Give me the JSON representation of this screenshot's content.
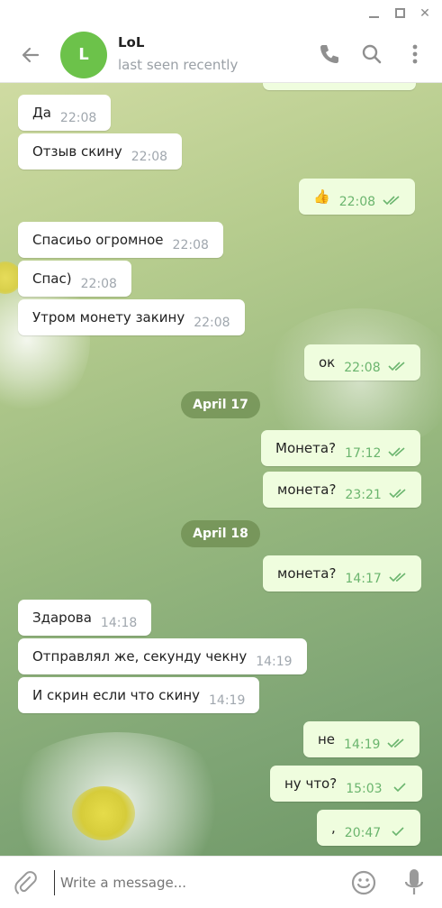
{
  "window": {
    "minimize_label": "",
    "maximize_label": "",
    "close_label": "✕"
  },
  "header": {
    "avatar_letter": "L",
    "name": "LoL",
    "status": "last seen recently"
  },
  "colors": {
    "accent": "#6cc24a",
    "outgoing_bubble": "#effdde",
    "incoming_bubble": "#ffffff",
    "read_ticks": "#6bb56e",
    "date_pill": "#6e8c50"
  },
  "messages": [
    {
      "dir": "in",
      "text": "Да",
      "time": "22:08"
    },
    {
      "dir": "in",
      "text": "Отзыв скину",
      "time": "22:08"
    },
    {
      "dir": "out",
      "text": "👍",
      "time": "22:08",
      "status": "read"
    },
    {
      "dir": "in",
      "text": "Спасиьо огромное",
      "time": "22:08"
    },
    {
      "dir": "in",
      "text": "Спас)",
      "time": "22:08"
    },
    {
      "dir": "in",
      "text": "Утром монету закину",
      "time": "22:08"
    },
    {
      "dir": "out",
      "text": "ок",
      "time": "22:08",
      "status": "read"
    },
    {
      "date": "April 17"
    },
    {
      "dir": "out",
      "text": "Монета?",
      "time": "17:12",
      "status": "read"
    },
    {
      "dir": "out",
      "text": "монета?",
      "time": "23:21",
      "status": "read"
    },
    {
      "date": "April 18"
    },
    {
      "dir": "out",
      "text": "монета?",
      "time": "14:17",
      "status": "read"
    },
    {
      "dir": "in",
      "text": "Здарова",
      "time": "14:18"
    },
    {
      "dir": "in",
      "text": "Отправлял же, секунду чекну",
      "time": "14:19"
    },
    {
      "dir": "in",
      "text": "И скрин если что скину",
      "time": "14:19"
    },
    {
      "dir": "out",
      "text": "не",
      "time": "14:19",
      "status": "read"
    },
    {
      "dir": "out",
      "text": "ну что?",
      "time": "15:03",
      "status": "sent"
    },
    {
      "dir": "out",
      "text": ",",
      "time": "20:47",
      "status": "sent"
    }
  ],
  "input": {
    "placeholder": "Write a message..."
  },
  "icons": {
    "back": "arrow-left-icon",
    "call": "phone-icon",
    "search": "search-icon",
    "menu": "more-vertical-icon",
    "attach": "paperclip-icon",
    "emoji": "emoji-icon",
    "mic": "microphone-icon"
  }
}
